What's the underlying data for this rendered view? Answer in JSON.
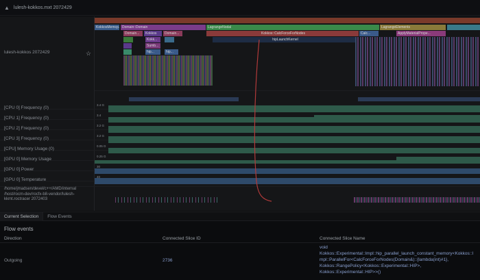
{
  "window": {
    "title": "lulesh-kokkos.mxt 2072429"
  },
  "process_track": {
    "label": "lulesh-kokkos 2072429"
  },
  "flame_labels": {
    "kokkos_mem": "KokkosMemcp...",
    "domain": "Domain::Domain",
    "lagrange_nodal": "LagrangeNodal",
    "lagrange_elements": "LagrangeElements",
    "domain_sub": "Domain...",
    "kokkos_a": "Kokkos",
    "domain_b": "Domain...",
    "calc_force": "Kokkos::CalcForceForNodes",
    "calc": "Calc...",
    "apply_material": "ApplyMaterialPrope...",
    "hip_launch": "hipLaunchKernel",
    "kokk": "Kokk...",
    "sumb": "Sumb...",
    "hip1": "hip...",
    "hip2": "hip..."
  },
  "tracks": [
    {
      "label": "[CPU 0] Frequency (0)",
      "value": "3.4 G"
    },
    {
      "label": "[CPU 1] Frequency (0)",
      "value": "3.4"
    },
    {
      "label": "[CPU 2] Frequency (0)",
      "value": "3.2 G"
    },
    {
      "label": "[CPU 3] Frequency (0)",
      "value": "3.2 G"
    },
    {
      "label": "[CPU] Memory Usage (0)",
      "value": "0.05 G"
    },
    {
      "label": "[GPU 0] Memory Usage",
      "value": "0.25 G"
    },
    {
      "label": "[GPU 0] Power",
      "value": "30"
    },
    {
      "label": "[GPU 0] Temperature",
      "value": "40"
    }
  ],
  "sample_track": {
    "line1": "/home/jmadsen/devel/c++/AMD/internal",
    "line2": "/host/rocm-dev/rocfx-b8-vendor/lulesh-",
    "line3": "kkmt.roctracer 2072403"
  },
  "tabs": {
    "current_selection": "Current Selection",
    "flow_events": "Flow Events"
  },
  "details": {
    "title": "Flow events",
    "headers": {
      "direction": "Direction",
      "connected_slice_id": "Connected Slice ID",
      "connected_slice_name": "Connected Slice Name"
    },
    "row": {
      "direction": "Outgoing",
      "slice_id": "2736",
      "name_line1": "void",
      "name_line2": "Kokkos::Experimental::Impl::hip_parallel_launch_constant_memory<Kokkos::I",
      "name_line3": "mpl::ParallelFor<CalcForceForNodes(Domain&)::{lambda(int)#1},",
      "name_line4": "Kokkos::RangePolicy<Kokkos::Experimental::HIP>,",
      "name_line5": "Kokkos::Experimental::HIP>>()"
    }
  },
  "colors": {
    "flow_arrow": "#b23a3a"
  }
}
